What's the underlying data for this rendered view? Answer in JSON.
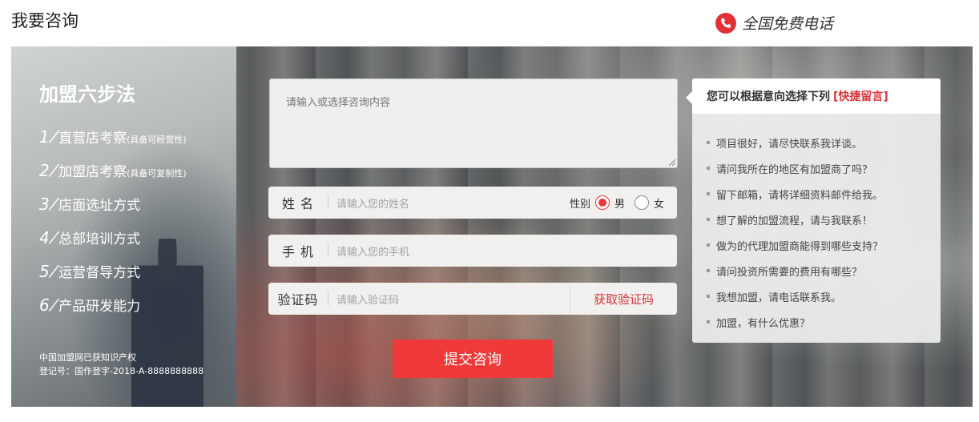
{
  "page_title": "我要咨询",
  "hotline": {
    "label": "全国免费电话"
  },
  "left_panel": {
    "title": "加盟六步法",
    "steps": [
      {
        "num": "1",
        "text": "直营店考察",
        "note": "(具备可经营性)"
      },
      {
        "num": "2",
        "text": "加盟店考察",
        "note": "(具备可复制性)"
      },
      {
        "num": "3",
        "text": "店面选址方式",
        "note": ""
      },
      {
        "num": "4",
        "text": "总部培训方式",
        "note": ""
      },
      {
        "num": "5",
        "text": "运营督导方式",
        "note": ""
      },
      {
        "num": "6",
        "text": "产品研发能力",
        "note": ""
      }
    ],
    "copyright_line1": "中国加盟网已获知识产权",
    "copyright_line2": "登记号：国作登字-2018-A-8888888888"
  },
  "form": {
    "consult_placeholder": "请输入或选择咨询内容",
    "name_label": "姓 名",
    "name_placeholder": "请输入您的姓名",
    "gender_label": "性别",
    "gender_male": "男",
    "gender_female": "女",
    "gender_selected": "男",
    "phone_label": "手 机",
    "phone_placeholder": "请输入您的手机",
    "captcha_label": "验证码",
    "captcha_placeholder": "请输入验证码",
    "captcha_button": "获取验证码",
    "submit_label": "提交咨询"
  },
  "quick": {
    "heading": "您可以根据意向选择下列",
    "heading_link": "[快捷留言]",
    "items": [
      "项目很好，请尽快联系我详谈。",
      "请问我所在的地区有加盟商了吗？",
      "留下邮箱，请将详细资料邮件给我。",
      "想了解的加盟流程，请与我联系！",
      "做为的代理加盟商能得到哪些支持？",
      "请问投资所需要的费用有哪些？",
      "我想加盟，请电话联系我。",
      "加盟，有什么优惠？"
    ]
  },
  "colors": {
    "accent": "#e8393b",
    "submit": "#f03a3a"
  },
  "icons": {
    "hotline": "phone-icon"
  }
}
